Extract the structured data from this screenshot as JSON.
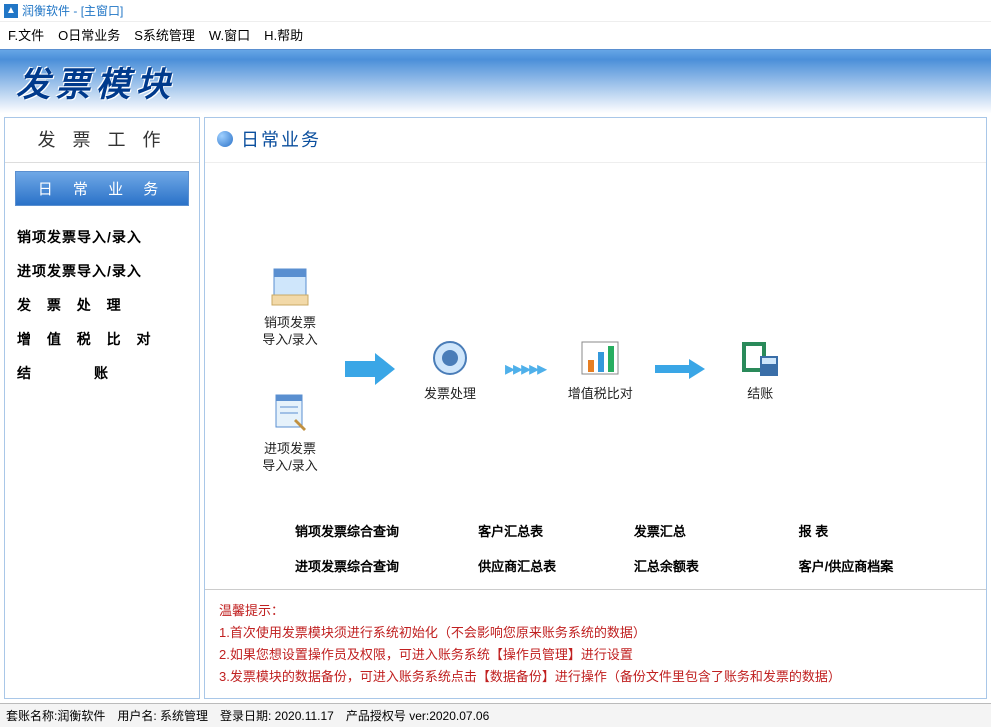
{
  "titlebar": {
    "app_name": "润衡软件",
    "window": "[主窗口]"
  },
  "menubar": [
    "F.文件",
    "O日常业务",
    "S系统管理",
    "W.窗口",
    "H.帮助"
  ],
  "banner": {
    "title": "发票模块"
  },
  "sidebar": {
    "title": "发 票 工 作",
    "active": "日 常 业 务",
    "items": [
      {
        "label": "销项发票导入/录入",
        "cls": ""
      },
      {
        "label": "进项发票导入/录入",
        "cls": ""
      },
      {
        "label": "发 票 处 理",
        "cls": "spaced"
      },
      {
        "label": "增 值 税 比 对",
        "cls": "spaced"
      },
      {
        "label": "结      账",
        "cls": "wide",
        "raw": "结账"
      }
    ]
  },
  "main": {
    "header": "日常业务",
    "flow": {
      "in1": "销项发票\n导入/录入",
      "in2": "进项发票\n导入/录入",
      "step2": "发票处理",
      "step3": "增值税比对",
      "step4": "结账"
    },
    "links": {
      "c1": [
        "销项发票综合查询",
        "进项发票综合查询"
      ],
      "c2": [
        "客户汇总表",
        "供应商汇总表"
      ],
      "c3": [
        "发票汇总",
        "汇总余额表"
      ],
      "c4": [
        "报    表",
        "客户/供应商档案"
      ]
    },
    "tips": {
      "title": "温馨提示：",
      "lines": [
        "1.首次使用发票模块须进行系统初始化（不会影响您原来账务系统的数据）",
        "2.如果您想设置操作员及权限，可进入账务系统【操作员管理】进行设置",
        "3.发票模块的数据备份，可进入账务系统点击【数据备份】进行操作（备份文件里包含了账务和发票的数据）"
      ]
    }
  },
  "statusbar": {
    "account": "套账名称:润衡软件",
    "user": "用户名: 系统管理",
    "login": "登录日期: 2020.11.17",
    "license": "产品授权号  ver:2020.07.06"
  }
}
